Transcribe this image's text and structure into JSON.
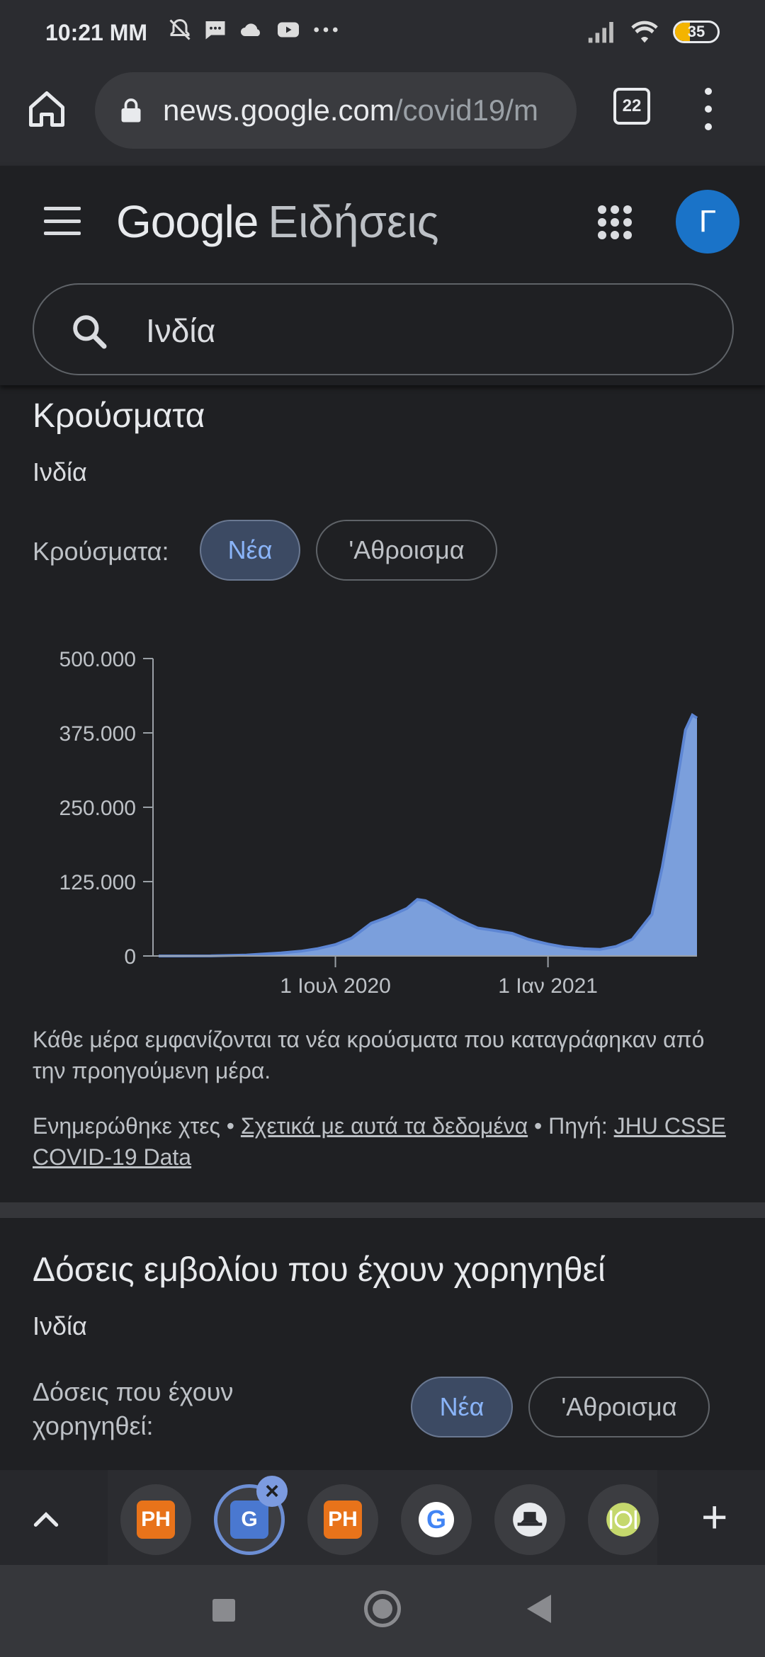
{
  "status": {
    "time": "10:21 MM",
    "battery": "35",
    "icons_left": [
      "mute-icon",
      "message-icon",
      "cloud-icon",
      "youtube-icon",
      "more-icon"
    ],
    "icons_right": [
      "signal-icon",
      "wifi-icon",
      "battery-icon"
    ]
  },
  "browser": {
    "url_domain": "news.google.com",
    "url_path": "/covid19/m",
    "tab_count": "22"
  },
  "header": {
    "logo_google": "Google",
    "logo_news": "Ειδήσεις",
    "avatar_letter": "Γ",
    "search_value": "Ινδία"
  },
  "cases": {
    "title": "Κρούσματα",
    "region": "Ινδία",
    "toggle_label": "Κρούσματα:",
    "chip_new": "Νέα",
    "chip_total": "'Αθροισμα",
    "caption": "Κάθε μέρα εμφανίζονται τα νέα κρούσματα που καταγράφηκαν από την προηγούμενη μέρα.",
    "updated": "Ενημερώθηκε χτες",
    "sep1": " • ",
    "about_link": "Σχετικά με αυτά τα δεδομένα",
    "sep2": " • Πηγή: ",
    "source_link": "JHU CSSE COVID-19 Data"
  },
  "vaccines": {
    "title": "Δόσεις εμβολίου που έχουν χορηγηθεί",
    "region": "Ινδία",
    "toggle_label_1": "Δόσεις που έχουν",
    "toggle_label_2": "χορηγηθεί:",
    "chip_new": "Νέα",
    "chip_total": "'Αθροισμα"
  },
  "tabstrip": {
    "tabs": [
      "PH",
      "G",
      "PH",
      "G",
      "hat",
      "dish"
    ],
    "close_label": "×",
    "add_label": "+"
  },
  "chart_data": {
    "type": "area",
    "title": "",
    "xlabel": "",
    "ylabel": "",
    "ylim": [
      0,
      500000
    ],
    "yticks": [
      "0",
      "125.000",
      "250.000",
      "375.000",
      "500.000"
    ],
    "ytick_values": [
      0,
      125000,
      250000,
      375000,
      500000
    ],
    "xticks": [
      "1 Ιουλ 2020",
      "1 Ιαν 2021"
    ],
    "xtick_dates": [
      "2020-07-01",
      "2021-01-01"
    ],
    "x": [
      "2020-01-30",
      "2020-03-15",
      "2020-04-15",
      "2020-05-15",
      "2020-06-01",
      "2020-06-15",
      "2020-07-01",
      "2020-07-15",
      "2020-08-01",
      "2020-08-15",
      "2020-09-01",
      "2020-09-10",
      "2020-09-17",
      "2020-10-01",
      "2020-10-15",
      "2020-11-01",
      "2020-11-15",
      "2020-12-01",
      "2020-12-15",
      "2021-01-01",
      "2021-01-15",
      "2021-02-01",
      "2021-02-15",
      "2021-03-01",
      "2021-03-15",
      "2021-04-01",
      "2021-04-10",
      "2021-04-20",
      "2021-04-30",
      "2021-05-06",
      "2021-05-10"
    ],
    "y": [
      0,
      100,
      1500,
      5000,
      8000,
      12000,
      19000,
      30000,
      55000,
      65000,
      80000,
      95000,
      93000,
      78000,
      62000,
      47000,
      43000,
      38000,
      28000,
      20000,
      15000,
      12000,
      11000,
      16000,
      28000,
      70000,
      150000,
      260000,
      380000,
      405000,
      400000
    ],
    "grid": false,
    "series": [
      {
        "values": [
          0,
          100,
          1500,
          5000,
          8000,
          12000,
          19000,
          30000,
          55000,
          65000,
          80000,
          95000,
          93000,
          78000,
          62000,
          47000,
          43000,
          38000,
          28000,
          20000,
          15000,
          12000,
          11000,
          16000,
          28000,
          70000,
          150000,
          260000,
          380000,
          405000,
          400000
        ]
      }
    ],
    "colors": {
      "fill": "#7b9fdc",
      "line": "#5d86d4"
    }
  },
  "colors": {
    "accent": "#8ab4f8",
    "avatar": "#1a73c8",
    "chip_active_bg": "#3c4a63"
  }
}
